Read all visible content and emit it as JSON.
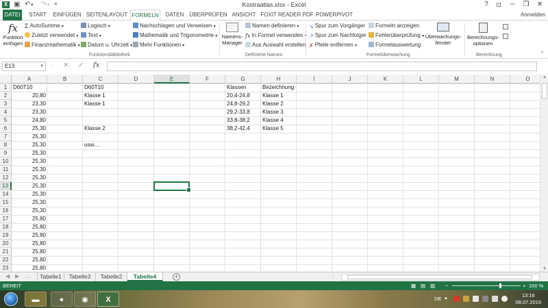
{
  "titlebar": {
    "title": "Kostraatlas.xlsx - Excel",
    "help": "?",
    "minimize": "─",
    "restore": "❐",
    "close": "✕",
    "ribbon_options": "⊡"
  },
  "tabs": [
    "DATEI",
    "START",
    "EINFÜGEN",
    "SEITENLAYOUT",
    "FORMELN",
    "DATEN",
    "ÜBERPRÜFEN",
    "ANSICHT",
    "FOXIT READER PDF",
    "POWERPIVOT"
  ],
  "active_tab": "FORMELN",
  "account": "Anmelden",
  "ribbon": {
    "insert_function": [
      "Funktion",
      "einfügen"
    ],
    "library": {
      "autosum": "AutoSumme",
      "recent": "Zuletzt verwendet",
      "financial": "Finanzmathematik",
      "logical": "Logisch",
      "text": "Text",
      "datetime": "Datum u. Uhrzeit",
      "lookup": "Nachschlagen und Verweisen",
      "math": "Mathematik und Trigonometrie",
      "more": "Mehr Funktionen",
      "group_label": "Funktionsbibliothek"
    },
    "names": {
      "manager": [
        "Namens-",
        "Manager"
      ],
      "define": "Namen definieren",
      "use_in_formula": "In Formel verwenden",
      "create_from_selection": "Aus Auswahl erstellen",
      "group_label": "Definierte Namen"
    },
    "auditing": {
      "trace_precedents": "Spur zum Vorgänger",
      "trace_dependents": "Spur zum Nachfolger",
      "remove_arrows": "Pfeile entfernen",
      "show_formulas": "Formeln anzeigen",
      "error_checking": "Fehlerüberprüfung",
      "evaluate": "Formelauswertung",
      "watch_window": [
        "Überwachungs-",
        "fenster"
      ],
      "group_label": "Formelüberwachung"
    },
    "calculation": {
      "options": [
        "Berechnungs-",
        "optionen"
      ],
      "group_label": "Berechnung"
    }
  },
  "formula_bar": {
    "name_box": "E13",
    "cancel": "✕",
    "enter": "✓",
    "fx": "fx",
    "value": ""
  },
  "columns": [
    "A",
    "B",
    "C",
    "D",
    "E",
    "F",
    "G",
    "H",
    "I",
    "J",
    "K",
    "L",
    "M",
    "N",
    "O"
  ],
  "selected_column": "E",
  "rows": [
    "1",
    "2",
    "3",
    "4",
    "5",
    "6",
    "7",
    "8",
    "9",
    "10",
    "11",
    "12",
    "13",
    "14",
    "15",
    "16",
    "17",
    "18",
    "19",
    "20",
    "21",
    "22",
    "23"
  ],
  "selected_row": "13",
  "cells": {
    "A": [
      "D60T10",
      "20,80",
      "23,30",
      "23,30",
      "24,80",
      "25,30",
      "25,30",
      "25,30",
      "25,30",
      "25,30",
      "25,30",
      "25,30",
      "25,30",
      "25,30",
      "25,30",
      "25,30",
      "25,80",
      "25,80",
      "25,80",
      "25,80",
      "25,80",
      "25,80",
      "25,80"
    ],
    "C": {
      "1": "D60T10",
      "2": "Klasse 1",
      "3": "Klasse 1",
      "6": "Klasse 2",
      "8": "usw...."
    },
    "G": [
      "Klassen",
      "20,4-24,8",
      "24,8-29,2",
      "29,2-33,8",
      "33,8-38,2",
      "38,2-42,4"
    ],
    "H": [
      "Bezeichnung",
      "Klasse 1",
      "Klasse 2",
      "Klasse 3",
      "Klasse 4",
      "Klasse 5"
    ]
  },
  "sheets": [
    "Tabelle1",
    "Tabelle3",
    "Tabelle2",
    "Tabelle4"
  ],
  "active_sheet": "Tabelle4",
  "status": {
    "ready": "BEREIT",
    "zoom": "100 %",
    "zoom_minus": "−",
    "zoom_plus": "+"
  },
  "taskbar": {
    "language": "DE",
    "time": "13:16",
    "date": "08.07.2016"
  },
  "colors": {
    "excel_green": "#217346",
    "grid": "#e1e1e1",
    "header_bg": "#f3f3f3"
  }
}
